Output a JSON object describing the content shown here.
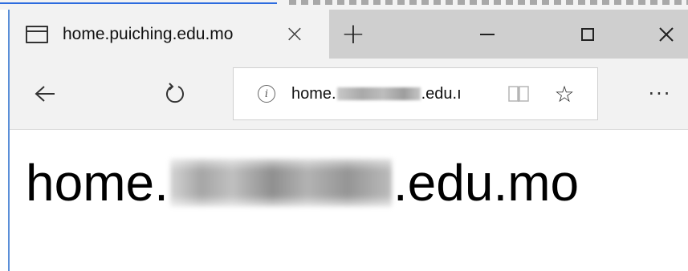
{
  "tab": {
    "title": "home.puiching.edu.mo",
    "close_glyph": "×",
    "new_tab_glyph": "+"
  },
  "window_controls": {
    "icons": [
      "minimize-icon",
      "maximize-icon",
      "close-icon"
    ],
    "close_glyph": "✕"
  },
  "toolbar": {
    "back_icon": "back-arrow-icon",
    "refresh_icon": "refresh-icon",
    "more_glyph": "···"
  },
  "address_bar": {
    "info_glyph": "i",
    "url_prefix": "home.",
    "url_suffix": ".edu.ı",
    "reading_view_icon": "book-icon",
    "favorite_glyph": "☆"
  },
  "page": {
    "heading_prefix": "home.",
    "heading_suffix": ".edu.mo"
  },
  "colors": {
    "accent_border": "#5b8fd8",
    "tab_bar": "#cfcfcf",
    "active_tab": "#f2f2f2",
    "toolbar": "#f2f2f2",
    "page_background": "#ffffff"
  }
}
